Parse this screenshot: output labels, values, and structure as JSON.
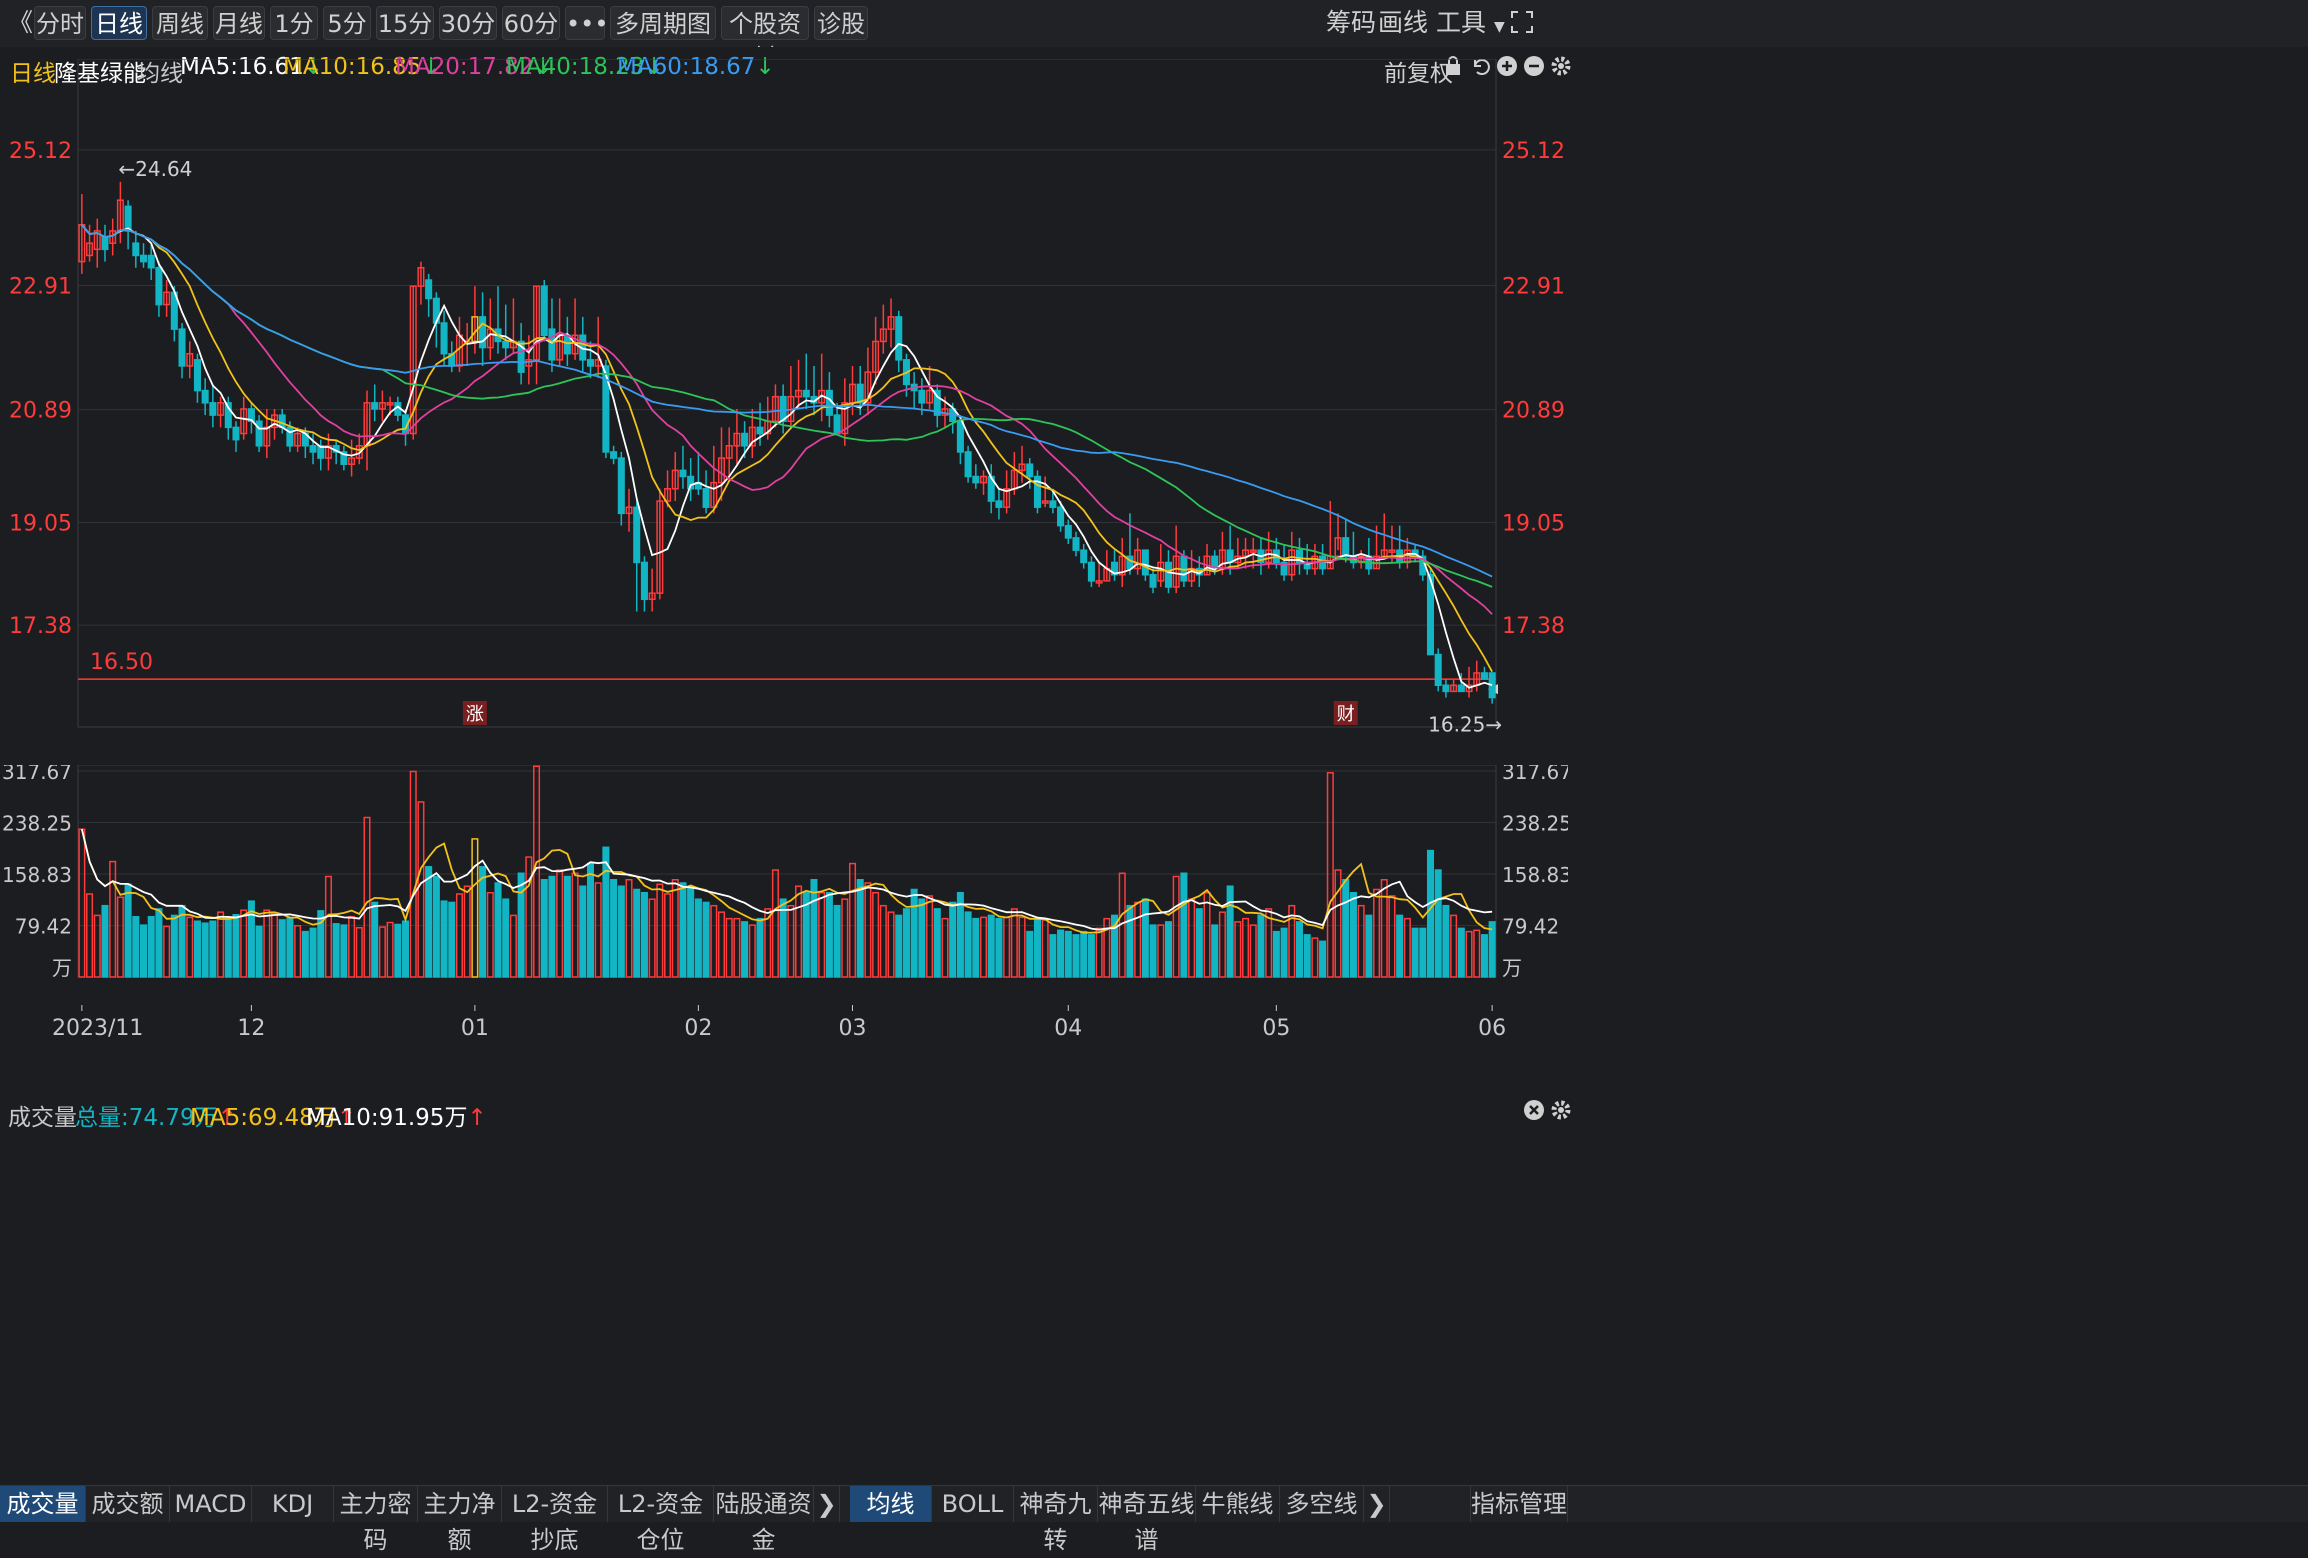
{
  "toolbar": {
    "back": "《",
    "periods": [
      "分时",
      "日线",
      "周线",
      "月线",
      "1分",
      "5分",
      "15分",
      "30分",
      "60分"
    ],
    "active": 1,
    "more": "•••",
    "multi": "多周期图",
    "stock_info": "个股资料",
    "diagnose": "诊股",
    "right": [
      "筹码",
      "画线",
      "工具"
    ]
  },
  "info": {
    "period": "日线",
    "name": "隆基绿能",
    "avg_label": "均线",
    "ma": [
      {
        "label": "MA5:16.61",
        "color": "#ffffff",
        "dir": "↓"
      },
      {
        "label": "MA10:16.85",
        "color": "#f2c21b",
        "dir": "↓"
      },
      {
        "label": "MA20:17.82",
        "color": "#e040a0",
        "dir": "↓"
      },
      {
        "label": "MA40:18.23",
        "color": "#2ec45a",
        "dir": "↓"
      },
      {
        "label": "MA60:18.67",
        "color": "#3a9cf0",
        "dir": "↓"
      }
    ],
    "adjust": "前复权"
  },
  "volume_info": {
    "title": "成交量",
    "total": "总量:74.79万",
    "ma5": "MA5:69.48万",
    "ma10": "MA10:91.95万"
  },
  "bottom_tabs": [
    "成交量",
    "成交额",
    "MACD",
    "KDJ",
    "主力密码",
    "主力净额",
    "L2-资金抄底",
    "L2-资金仓位",
    "陆股通资金"
  ],
  "bottom_tabs2": [
    "均线",
    "BOLL",
    "神奇九转",
    "神奇五线谱",
    "牛熊线",
    "多空线"
  ],
  "indicator_mgmt": "指标管理",
  "colors": {
    "up": "#ff3b3b",
    "down": "#12b5c4",
    "ma5": "#ffffff",
    "ma10": "#f2c21b",
    "ma20": "#e040a0",
    "ma40": "#2ec45a",
    "ma60": "#3a9cf0"
  },
  "chart_data": {
    "type": "candlestick",
    "price_ticks": [
      25.12,
      22.91,
      20.89,
      19.05,
      17.38
    ],
    "price_range": [
      15.72,
      26.6
    ],
    "volume_ticks": [
      "317.67",
      "238.25",
      "158.83",
      "79.42"
    ],
    "volume_unit": "万",
    "volume_range": [
      0,
      327
    ],
    "x_ticks": [
      {
        "label": "2023/11",
        "i": 0
      },
      {
        "label": "12",
        "i": 22
      },
      {
        "label": "01",
        "i": 51
      },
      {
        "label": "02",
        "i": 80
      },
      {
        "label": "03",
        "i": 100
      },
      {
        "label": "04",
        "i": 128
      },
      {
        "label": "05",
        "i": 155
      },
      {
        "label": "06",
        "i": 183
      }
    ],
    "annotations": {
      "high": "←24.64",
      "low": "16.25→",
      "level_label": "16.50",
      "level": 16.5
    },
    "events": [
      {
        "label": "涨",
        "i": 51
      },
      {
        "label": "财",
        "i": 164
      }
    ],
    "candles": [
      [
        23.3,
        23.9,
        24.4,
        23.1,
        228
      ],
      [
        23.4,
        23.6,
        23.9,
        23.3,
        128
      ],
      [
        23.5,
        23.8,
        24.0,
        23.2,
        95
      ],
      [
        23.7,
        23.5,
        23.9,
        23.3,
        110
      ],
      [
        23.6,
        23.8,
        24.0,
        23.4,
        178
      ],
      [
        23.8,
        24.3,
        24.6,
        23.6,
        123
      ],
      [
        24.2,
        23.8,
        24.3,
        23.5,
        143
      ],
      [
        23.6,
        23.4,
        23.8,
        23.2,
        93
      ],
      [
        23.4,
        23.3,
        23.6,
        23.2,
        80
      ],
      [
        23.4,
        23.2,
        23.6,
        23.0,
        93
      ],
      [
        23.2,
        22.6,
        23.3,
        22.4,
        105
      ],
      [
        22.6,
        22.8,
        23.0,
        22.4,
        78
      ],
      [
        22.8,
        22.2,
        22.9,
        22.0,
        95
      ],
      [
        22.2,
        21.6,
        22.3,
        21.4,
        110
      ],
      [
        21.6,
        21.8,
        22.0,
        21.4,
        92
      ],
      [
        21.7,
        21.2,
        21.8,
        21.0,
        86
      ],
      [
        21.2,
        21.0,
        21.4,
        20.8,
        83
      ],
      [
        21.0,
        20.8,
        21.3,
        20.6,
        86
      ],
      [
        20.8,
        21.0,
        21.1,
        20.6,
        100
      ],
      [
        21.0,
        20.6,
        21.1,
        20.4,
        92
      ],
      [
        20.6,
        20.4,
        20.7,
        20.2,
        96
      ],
      [
        20.5,
        20.9,
        21.1,
        20.4,
        103
      ],
      [
        20.9,
        20.7,
        21.0,
        20.5,
        117
      ],
      [
        20.7,
        20.3,
        20.8,
        20.2,
        78
      ],
      [
        20.3,
        20.6,
        20.9,
        20.1,
        103
      ],
      [
        20.6,
        20.8,
        20.9,
        20.4,
        98
      ],
      [
        20.8,
        20.6,
        20.9,
        20.5,
        88
      ],
      [
        20.6,
        20.3,
        20.7,
        20.2,
        91
      ],
      [
        20.3,
        20.5,
        20.6,
        20.2,
        79
      ],
      [
        20.5,
        20.3,
        20.6,
        20.1,
        70
      ],
      [
        20.3,
        20.2,
        20.5,
        20.0,
        75
      ],
      [
        20.3,
        20.1,
        20.4,
        19.9,
        102
      ],
      [
        20.1,
        20.3,
        20.5,
        19.9,
        155
      ],
      [
        20.3,
        20.2,
        20.4,
        20.0,
        82
      ],
      [
        20.2,
        20.0,
        20.3,
        19.9,
        80
      ],
      [
        20.0,
        20.1,
        20.4,
        19.8,
        93
      ],
      [
        20.1,
        20.3,
        20.5,
        20.0,
        76
      ],
      [
        20.3,
        21.0,
        21.2,
        19.9,
        246
      ],
      [
        21.0,
        20.9,
        21.3,
        20.7,
        115
      ],
      [
        20.9,
        21.0,
        21.2,
        20.7,
        77
      ],
      [
        21.0,
        21.0,
        21.1,
        20.8,
        84
      ],
      [
        21.0,
        20.8,
        21.1,
        20.7,
        81
      ],
      [
        20.8,
        20.5,
        20.9,
        20.3,
        86
      ],
      [
        20.5,
        22.9,
        22.9,
        20.4,
        317
      ],
      [
        22.9,
        23.2,
        23.3,
        22.6,
        270
      ],
      [
        23.0,
        22.7,
        23.1,
        22.4,
        170
      ],
      [
        22.7,
        22.3,
        22.8,
        21.9,
        155
      ],
      [
        22.3,
        21.8,
        22.5,
        21.6,
        117
      ],
      [
        21.8,
        21.6,
        22.0,
        21.5,
        115
      ],
      [
        21.6,
        22.1,
        22.4,
        21.5,
        128
      ],
      [
        22.0,
        22.0,
        22.3,
        21.6,
        140
      ],
      [
        22.0,
        22.4,
        22.9,
        21.8,
        213
      ],
      [
        22.4,
        21.9,
        22.8,
        21.6,
        170
      ],
      [
        21.9,
        22.2,
        22.7,
        21.7,
        130
      ],
      [
        22.2,
        22.0,
        22.9,
        21.8,
        145
      ],
      [
        22.0,
        21.9,
        22.6,
        21.7,
        120
      ],
      [
        21.9,
        22.0,
        22.7,
        21.8,
        95
      ],
      [
        22.0,
        21.5,
        22.3,
        21.3,
        160
      ],
      [
        21.6,
        21.7,
        22.1,
        21.3,
        185
      ],
      [
        21.7,
        22.9,
        22.9,
        21.3,
        325
      ],
      [
        22.9,
        22.1,
        23.0,
        22.0,
        150
      ],
      [
        22.2,
        21.7,
        22.7,
        21.5,
        155
      ],
      [
        21.7,
        22.1,
        22.7,
        21.6,
        165
      ],
      [
        22.1,
        21.8,
        22.4,
        21.6,
        155
      ],
      [
        21.8,
        22.1,
        22.7,
        21.7,
        160
      ],
      [
        22.1,
        21.7,
        22.4,
        21.5,
        140
      ],
      [
        21.7,
        21.6,
        22.0,
        21.4,
        175
      ],
      [
        21.6,
        21.7,
        22.4,
        21.4,
        145
      ],
      [
        21.6,
        20.2,
        21.7,
        20.1,
        200
      ],
      [
        20.2,
        20.1,
        20.3,
        20.0,
        150
      ],
      [
        20.1,
        19.2,
        20.2,
        19.0,
        140
      ],
      [
        19.2,
        19.3,
        19.6,
        18.9,
        150
      ],
      [
        19.3,
        18.4,
        19.4,
        17.6,
        135
      ],
      [
        18.4,
        17.8,
        18.5,
        17.6,
        130
      ],
      [
        17.8,
        17.9,
        18.3,
        17.6,
        120
      ],
      [
        17.9,
        19.4,
        19.6,
        17.8,
        143
      ],
      [
        19.4,
        19.6,
        19.9,
        19.3,
        128
      ],
      [
        19.6,
        19.9,
        20.2,
        19.4,
        150
      ],
      [
        19.9,
        19.8,
        20.3,
        19.6,
        145
      ],
      [
        19.8,
        19.6,
        20.1,
        19.4,
        140
      ],
      [
        19.7,
        19.6,
        20.2,
        19.5,
        120
      ],
      [
        19.6,
        19.3,
        19.9,
        19.2,
        115
      ],
      [
        19.3,
        19.7,
        20.3,
        19.2,
        110
      ],
      [
        19.7,
        20.1,
        20.6,
        19.4,
        100
      ],
      [
        20.1,
        20.3,
        20.6,
        19.8,
        90
      ],
      [
        20.3,
        20.5,
        20.9,
        20.0,
        90
      ],
      [
        20.5,
        20.3,
        20.7,
        20.1,
        85
      ],
      [
        20.3,
        20.6,
        20.9,
        20.1,
        80
      ],
      [
        20.6,
        20.5,
        21.0,
        20.3,
        90
      ],
      [
        20.5,
        20.7,
        21.1,
        20.4,
        105
      ],
      [
        20.7,
        21.1,
        21.3,
        20.6,
        165
      ],
      [
        21.1,
        20.7,
        21.3,
        20.5,
        120
      ],
      [
        20.7,
        21.1,
        21.6,
        20.6,
        110
      ],
      [
        21.1,
        21.2,
        21.7,
        20.9,
        140
      ],
      [
        21.2,
        21.1,
        21.8,
        20.9,
        130
      ],
      [
        21.1,
        21.0,
        21.6,
        20.8,
        150
      ],
      [
        21.0,
        21.2,
        21.8,
        20.7,
        130
      ],
      [
        21.2,
        20.8,
        21.5,
        20.6,
        130
      ],
      [
        20.8,
        20.5,
        21.0,
        20.5,
        110
      ],
      [
        20.5,
        21.0,
        21.4,
        20.3,
        120
      ],
      [
        21.0,
        21.3,
        21.6,
        20.8,
        175
      ],
      [
        21.3,
        21.0,
        21.6,
        20.8,
        150
      ],
      [
        21.0,
        21.5,
        21.9,
        20.8,
        145
      ],
      [
        21.5,
        22.0,
        22.4,
        21.3,
        130
      ],
      [
        22.0,
        22.2,
        22.6,
        21.8,
        110
      ],
      [
        22.2,
        22.4,
        22.7,
        21.9,
        100
      ],
      [
        22.4,
        21.7,
        22.5,
        21.5,
        95
      ],
      [
        21.7,
        21.3,
        21.8,
        21.1,
        105
      ],
      [
        21.3,
        21.2,
        21.5,
        20.9,
        135
      ],
      [
        21.2,
        21.0,
        21.4,
        20.8,
        120
      ],
      [
        21.0,
        21.2,
        21.6,
        20.9,
        125
      ],
      [
        21.2,
        20.8,
        21.3,
        20.6,
        105
      ],
      [
        20.8,
        20.9,
        21.1,
        20.6,
        90
      ],
      [
        20.9,
        20.7,
        21.0,
        20.5,
        115
      ],
      [
        20.7,
        20.2,
        20.8,
        20.0,
        130
      ],
      [
        20.2,
        19.8,
        20.3,
        19.7,
        100
      ],
      [
        19.8,
        19.7,
        20.0,
        19.6,
        90
      ],
      [
        19.7,
        19.8,
        19.9,
        19.5,
        92
      ],
      [
        19.8,
        19.4,
        20.0,
        19.2,
        95
      ],
      [
        19.4,
        19.3,
        19.6,
        19.1,
        90
      ],
      [
        19.3,
        19.6,
        19.9,
        19.2,
        92
      ],
      [
        19.6,
        19.9,
        20.2,
        19.5,
        105
      ],
      [
        19.9,
        20.0,
        20.3,
        19.7,
        92
      ],
      [
        20.0,
        19.8,
        20.1,
        19.6,
        70
      ],
      [
        19.8,
        19.3,
        19.9,
        19.2,
        90
      ],
      [
        19.4,
        19.4,
        19.8,
        19.3,
        88
      ],
      [
        19.4,
        19.3,
        19.6,
        19.2,
        65
      ],
      [
        19.3,
        19.0,
        19.4,
        18.9,
        72
      ],
      [
        19.0,
        18.8,
        19.1,
        18.7,
        70
      ],
      [
        18.8,
        18.6,
        18.9,
        18.5,
        65
      ],
      [
        18.6,
        18.4,
        18.7,
        18.3,
        70
      ],
      [
        18.4,
        18.1,
        18.5,
        18.0,
        65
      ],
      [
        18.1,
        18.1,
        18.4,
        18.0,
        75
      ],
      [
        18.1,
        18.3,
        18.6,
        18.1,
        90
      ],
      [
        18.4,
        18.2,
        18.6,
        18.1,
        95
      ],
      [
        18.2,
        18.5,
        18.8,
        18.0,
        160
      ],
      [
        18.5,
        18.3,
        19.2,
        18.2,
        110
      ],
      [
        18.3,
        18.6,
        18.8,
        18.2,
        115
      ],
      [
        18.6,
        18.2,
        18.6,
        18.1,
        120
      ],
      [
        18.2,
        18.0,
        18.3,
        17.9,
        80
      ],
      [
        18.1,
        18.4,
        18.7,
        18.0,
        80
      ],
      [
        18.4,
        18.0,
        18.6,
        17.9,
        85
      ],
      [
        18.0,
        18.5,
        19.0,
        17.9,
        155
      ],
      [
        18.5,
        18.1,
        18.6,
        18.0,
        160
      ],
      [
        18.1,
        18.3,
        18.6,
        18.0,
        120
      ],
      [
        18.3,
        18.2,
        18.5,
        18.0,
        105
      ],
      [
        18.2,
        18.5,
        18.7,
        18.2,
        130
      ],
      [
        18.5,
        18.3,
        18.6,
        18.2,
        80
      ],
      [
        18.3,
        18.6,
        18.9,
        18.2,
        100
      ],
      [
        18.6,
        18.4,
        19.0,
        18.2,
        140
      ],
      [
        18.4,
        18.5,
        18.8,
        18.3,
        85
      ],
      [
        18.5,
        18.6,
        18.8,
        18.3,
        90
      ],
      [
        18.6,
        18.6,
        18.8,
        18.3,
        80
      ],
      [
        18.6,
        18.4,
        18.8,
        18.2,
        95
      ],
      [
        18.4,
        18.6,
        18.9,
        18.3,
        105
      ],
      [
        18.6,
        18.4,
        18.8,
        18.3,
        70
      ],
      [
        18.4,
        18.2,
        18.7,
        18.1,
        75
      ],
      [
        18.2,
        18.6,
        18.9,
        18.1,
        110
      ],
      [
        18.6,
        18.4,
        18.8,
        18.2,
        85
      ],
      [
        18.4,
        18.3,
        18.7,
        18.2,
        65
      ],
      [
        18.3,
        18.5,
        18.7,
        18.2,
        60
      ],
      [
        18.5,
        18.3,
        18.7,
        18.2,
        55
      ],
      [
        18.3,
        18.5,
        19.4,
        18.3,
        315
      ],
      [
        18.5,
        18.8,
        19.2,
        18.6,
        165
      ],
      [
        18.8,
        18.5,
        19.1,
        18.4,
        150
      ],
      [
        18.5,
        18.4,
        18.9,
        18.3,
        130
      ],
      [
        18.4,
        18.5,
        18.6,
        18.3,
        110
      ],
      [
        18.5,
        18.3,
        18.8,
        18.2,
        95
      ],
      [
        18.3,
        18.5,
        19.0,
        18.3,
        135
      ],
      [
        18.5,
        18.6,
        19.2,
        18.5,
        150
      ],
      [
        18.6,
        18.6,
        19.0,
        18.4,
        125
      ],
      [
        18.6,
        18.4,
        19.0,
        18.3,
        95
      ],
      [
        18.4,
        18.6,
        18.8,
        18.3,
        90
      ],
      [
        18.6,
        18.5,
        18.7,
        18.4,
        75
      ],
      [
        18.5,
        18.2,
        18.6,
        18.1,
        75
      ],
      [
        18.2,
        16.9,
        18.3,
        16.9,
        195
      ],
      [
        16.9,
        16.4,
        17.0,
        16.3,
        165
      ],
      [
        16.4,
        16.3,
        16.5,
        16.2,
        110
      ],
      [
        16.3,
        16.4,
        16.5,
        16.3,
        95
      ],
      [
        16.4,
        16.3,
        16.6,
        16.3,
        75
      ],
      [
        16.3,
        16.4,
        16.7,
        16.2,
        70
      ],
      [
        16.4,
        16.6,
        16.8,
        16.3,
        72
      ],
      [
        16.6,
        16.5,
        16.7,
        16.5,
        65
      ],
      [
        16.6,
        16.2,
        16.6,
        16.1,
        85
      ]
    ]
  }
}
